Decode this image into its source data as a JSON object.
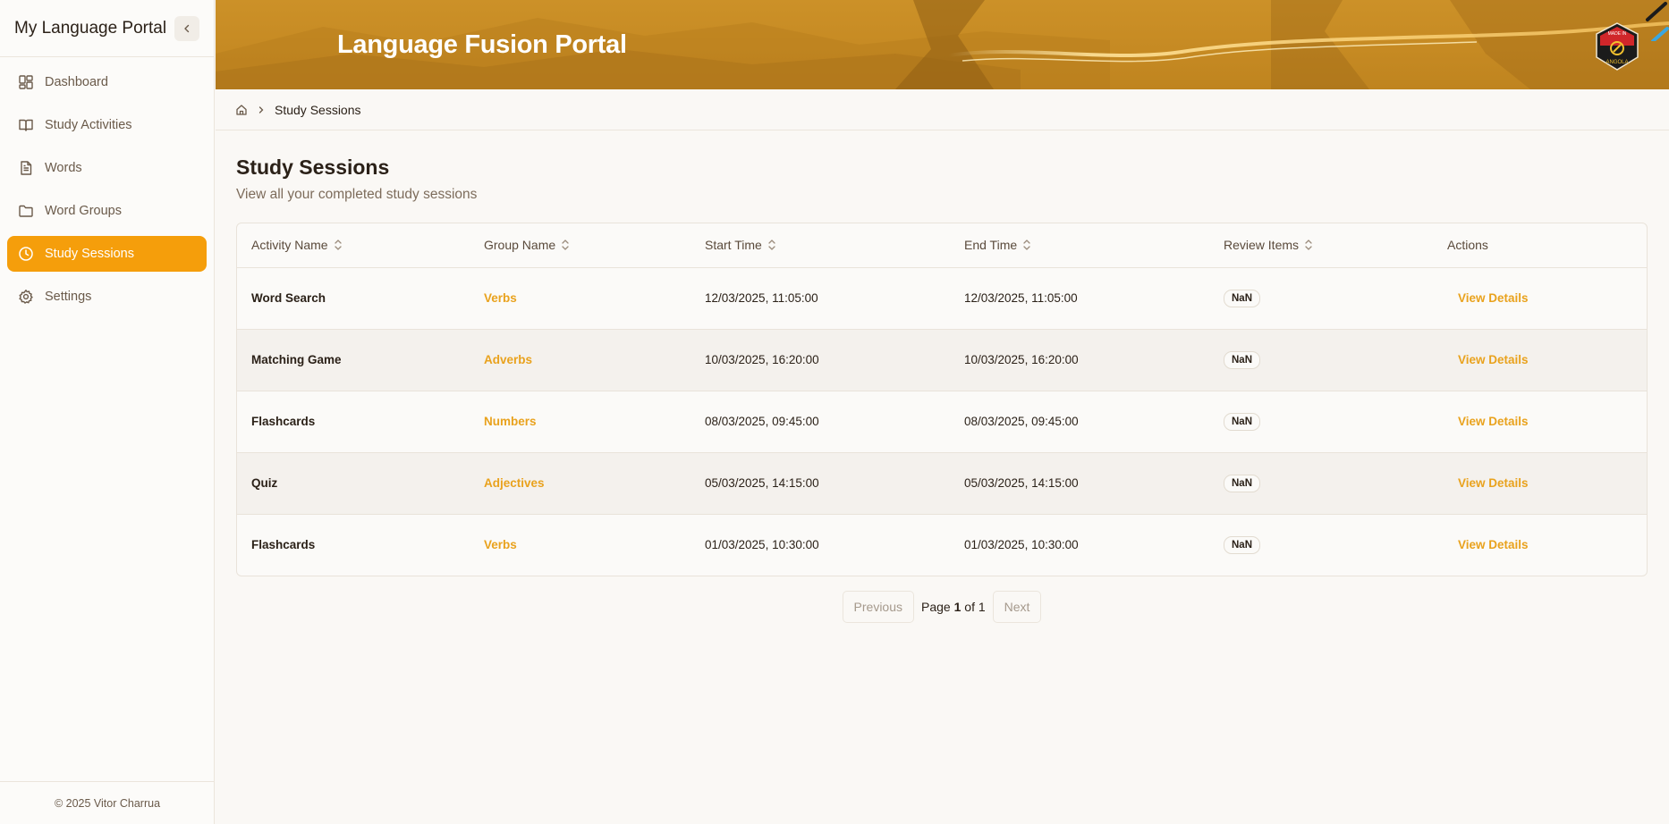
{
  "app": {
    "title": "My Language Portal"
  },
  "sidebar": {
    "items": [
      {
        "label": "Dashboard",
        "icon": "dashboard-icon",
        "active": false
      },
      {
        "label": "Study Activities",
        "icon": "book-open-icon",
        "active": false
      },
      {
        "label": "Words",
        "icon": "file-text-icon",
        "active": false
      },
      {
        "label": "Word Groups",
        "icon": "folder-icon",
        "active": false
      },
      {
        "label": "Study Sessions",
        "icon": "clock-icon",
        "active": true
      },
      {
        "label": "Settings",
        "icon": "gear-icon",
        "active": false
      }
    ],
    "footer": "© 2025 Vitor Charrua"
  },
  "banner": {
    "title": "Language Fusion Portal",
    "badge_text": [
      "MADE IN",
      "ANGOLA"
    ]
  },
  "breadcrumb": {
    "current": "Study Sessions"
  },
  "page": {
    "title": "Study Sessions",
    "subtitle": "View all your completed study sessions"
  },
  "table": {
    "columns": [
      "Activity Name",
      "Group Name",
      "Start Time",
      "End Time",
      "Review Items",
      "Actions"
    ],
    "rows": [
      {
        "activity": "Word Search",
        "group": "Verbs",
        "start": "12/03/2025, 11:05:00",
        "end": "12/03/2025, 11:05:00",
        "review": "NaN",
        "action": "View Details"
      },
      {
        "activity": "Matching Game",
        "group": "Adverbs",
        "start": "10/03/2025, 16:20:00",
        "end": "10/03/2025, 16:20:00",
        "review": "NaN",
        "action": "View Details"
      },
      {
        "activity": "Flashcards",
        "group": "Numbers",
        "start": "08/03/2025, 09:45:00",
        "end": "08/03/2025, 09:45:00",
        "review": "NaN",
        "action": "View Details"
      },
      {
        "activity": "Quiz",
        "group": "Adjectives",
        "start": "05/03/2025, 14:15:00",
        "end": "05/03/2025, 14:15:00",
        "review": "NaN",
        "action": "View Details"
      },
      {
        "activity": "Flashcards",
        "group": "Verbs",
        "start": "01/03/2025, 10:30:00",
        "end": "01/03/2025, 10:30:00",
        "review": "NaN",
        "action": "View Details"
      }
    ]
  },
  "pagination": {
    "previous": "Previous",
    "next": "Next",
    "page_word": "Page",
    "current": "1",
    "of_word": "of",
    "total": "1"
  },
  "colors": {
    "accent": "#f59e0b",
    "link": "#e9a21d",
    "banner": "#c68a23"
  }
}
